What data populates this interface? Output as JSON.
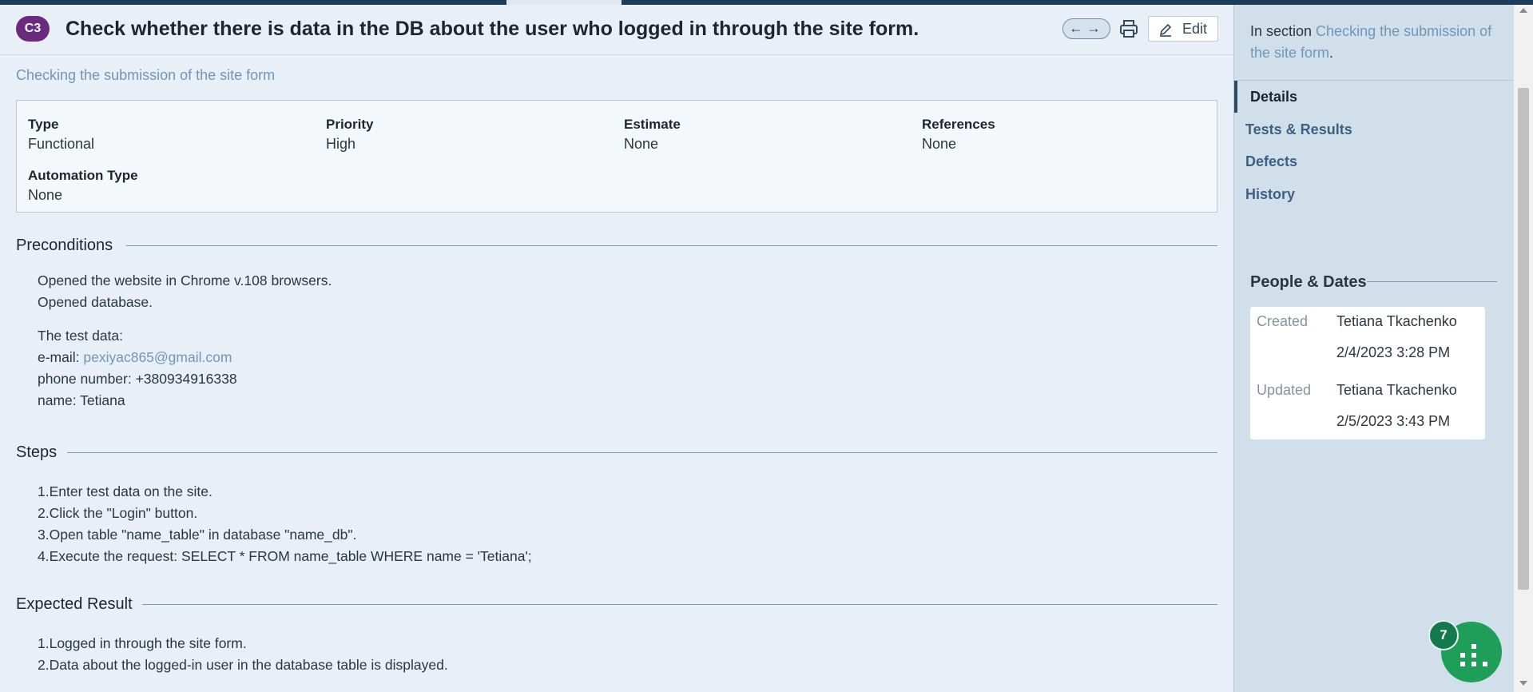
{
  "case": {
    "badge": "C3",
    "title": "Check whether there is data in the DB about the user who logged in through the site form.",
    "section_link": "Checking the submission of the site form"
  },
  "toolbar": {
    "nav_arrows": "←→",
    "edit_label": "Edit"
  },
  "properties": [
    {
      "key": "Type",
      "value": "Functional"
    },
    {
      "key": "Priority",
      "value": "High"
    },
    {
      "key": "Estimate",
      "value": "None"
    },
    {
      "key": "References",
      "value": "None"
    },
    {
      "key": "Automation Type",
      "value": "None"
    }
  ],
  "preconditions": {
    "heading": "Preconditions",
    "lines": [
      "Opened the website in Chrome v.108 browsers.",
      "Opened database."
    ],
    "test_data_label": "The test data:",
    "email_label": "e-mail: ",
    "email": "pexiyac865@gmail.com",
    "phone": "phone number: +380934916338",
    "name": "name: Tetiana"
  },
  "steps": {
    "heading": "Steps",
    "items": [
      "1.Enter test data on the site.",
      "2.Click the \"Login\" button.",
      "3.Open table \"name_table\" in database \"name_db\".",
      "4.Execute the request: SELECT * FROM name_table WHERE name = 'Tetiana';"
    ]
  },
  "expected": {
    "heading": "Expected Result",
    "items": [
      "1.Logged in through the site form.",
      "2.Data about the logged-in user in the database table is displayed."
    ]
  },
  "sidebar": {
    "in_section_prefix": "In section ",
    "in_section_link": "Checking the submission of the site form",
    "in_section_suffix": ".",
    "nav": [
      "Details",
      "Tests & Results",
      "Defects",
      "History"
    ],
    "active_nav": "Details",
    "people_heading": "People & Dates",
    "created_label": "Created",
    "created_by": "Tetiana Tkachenko",
    "created_at": "2/4/2023 3:28 PM",
    "updated_label": "Updated",
    "updated_by": "Tetiana Tkachenko",
    "updated_at": "2/5/2023 3:43 PM"
  },
  "widget": {
    "count": "7",
    "color": "#1f9e5a"
  },
  "colors": {
    "badge": "#6a2b7f",
    "link": "#6e97bb",
    "sidebar_bg": "#d0dfea",
    "page_bg": "#e8eff6"
  },
  "icons": [
    "arrow-left-icon",
    "arrow-right-icon",
    "print-icon",
    "pencil-icon",
    "grid-icon"
  ]
}
